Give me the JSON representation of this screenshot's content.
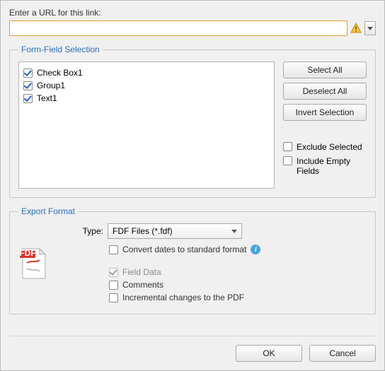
{
  "url_section": {
    "label": "Enter a URL for this link:",
    "value": "",
    "placeholder": ""
  },
  "form_field_selection": {
    "legend": "Form-Field Selection",
    "fields": [
      {
        "name": "Check Box1",
        "checked": true
      },
      {
        "name": "Group1",
        "checked": true
      },
      {
        "name": "Text1",
        "checked": true
      }
    ],
    "buttons": {
      "select_all": "Select All",
      "deselect_all": "Deselect All",
      "invert_selection": "Invert Selection"
    },
    "options": {
      "exclude_selected": {
        "label": "Exclude Selected",
        "checked": false
      },
      "include_empty": {
        "label": "Include Empty Fields",
        "checked": false
      }
    }
  },
  "export_format": {
    "legend": "Export Format",
    "type_label": "Type:",
    "type_value": "FDF Files (*.fdf)",
    "convert_dates": {
      "label": "Convert dates to standard format",
      "checked": false
    },
    "field_data": {
      "label": "Field Data",
      "checked": true,
      "disabled": true
    },
    "comments": {
      "label": "Comments",
      "checked": false,
      "disabled": false
    },
    "incremental": {
      "label": "Incremental changes to the PDF",
      "checked": false,
      "disabled": false
    }
  },
  "footer": {
    "ok": "OK",
    "cancel": "Cancel"
  }
}
